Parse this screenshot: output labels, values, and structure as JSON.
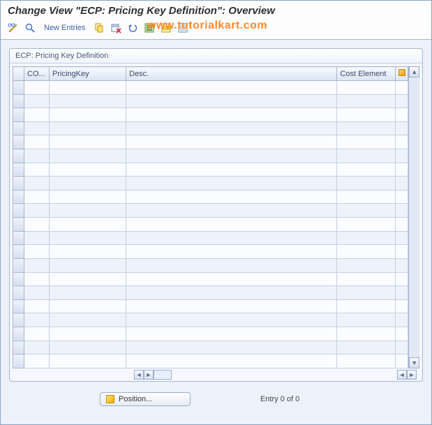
{
  "header": {
    "title": "Change View \"ECP: Pricing Key Definition\": Overview"
  },
  "toolbar": {
    "new_entries_label": "New Entries"
  },
  "watermark": "www.tutorialkart.com",
  "group": {
    "title": "ECP: Pricing Key Definition"
  },
  "table": {
    "columns": {
      "co": "CO...",
      "pricing_key": "PricingKey",
      "desc": "Desc.",
      "cost_element": "Cost Element"
    }
  },
  "footer": {
    "position_label": "Position...",
    "entry_status": "Entry 0 of 0"
  }
}
